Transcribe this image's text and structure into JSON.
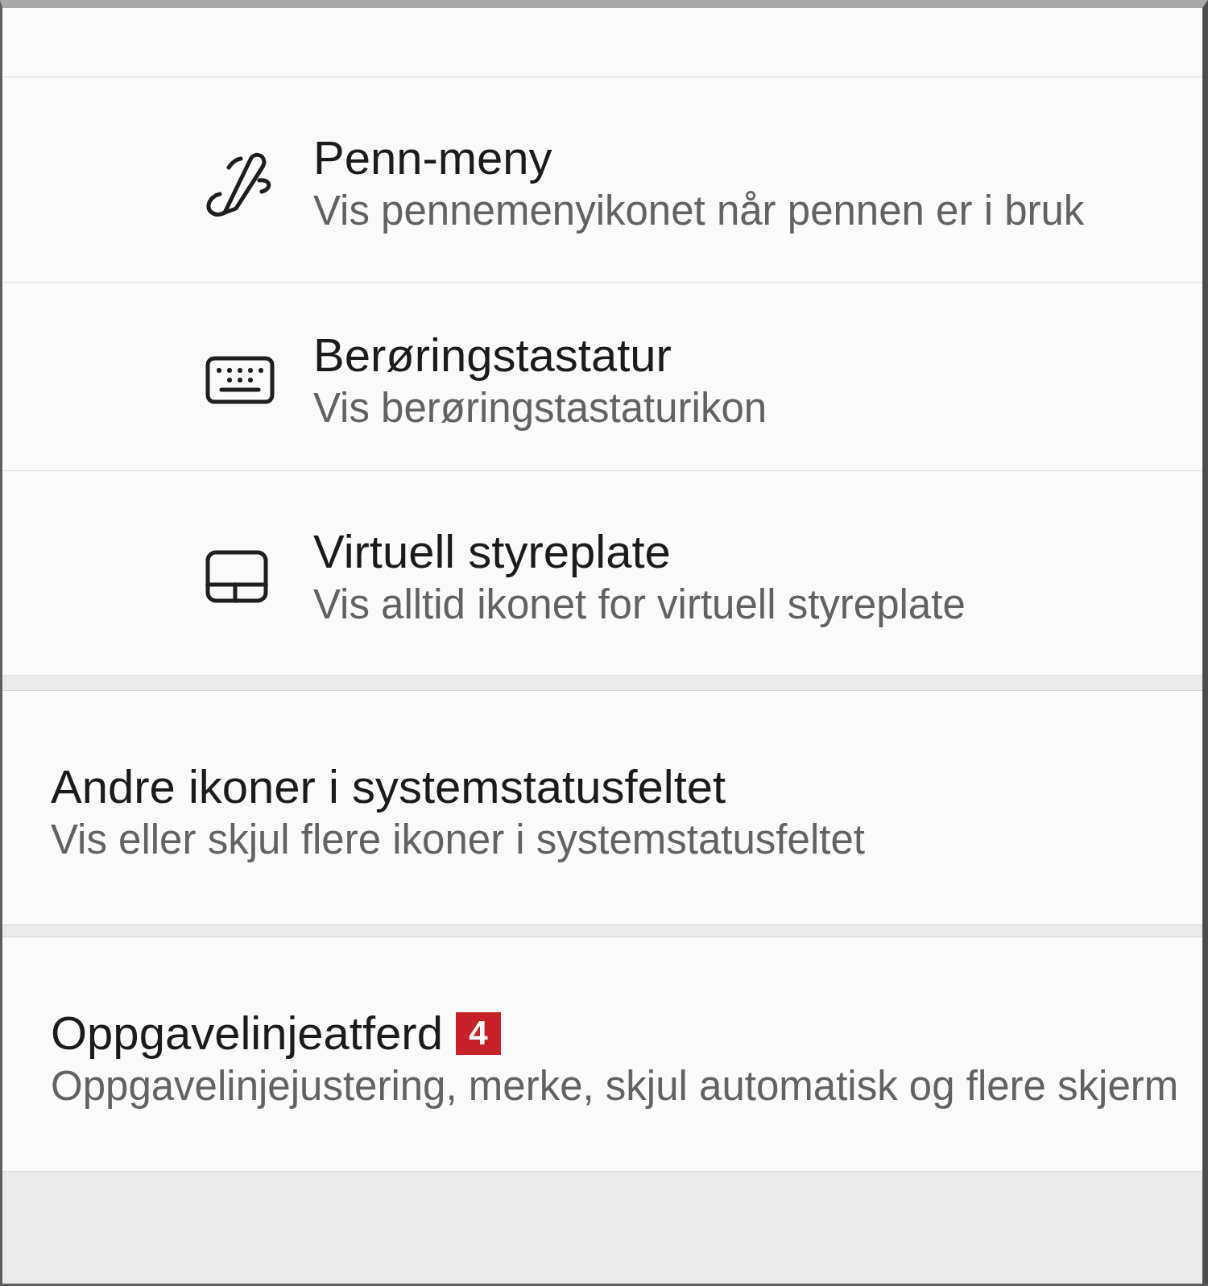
{
  "icon_settings": [
    {
      "title": "Penn-meny",
      "description": "Vis pennemenyikonet når pennen er i bruk"
    },
    {
      "title": "Berøringstastatur",
      "description": "Vis berøringstastaturikon"
    },
    {
      "title": "Virtuell styreplate",
      "description": "Vis alltid ikonet for virtuell styreplate"
    }
  ],
  "sections": [
    {
      "title": "Andre ikoner i systemstatusfeltet",
      "description": "Vis eller skjul flere ikoner i systemstatusfeltet"
    },
    {
      "title": "Oppgavelinjeatferd",
      "badge": "4",
      "description": "Oppgavelinjejustering, merke, skjul automatisk og flere skjerm"
    }
  ]
}
